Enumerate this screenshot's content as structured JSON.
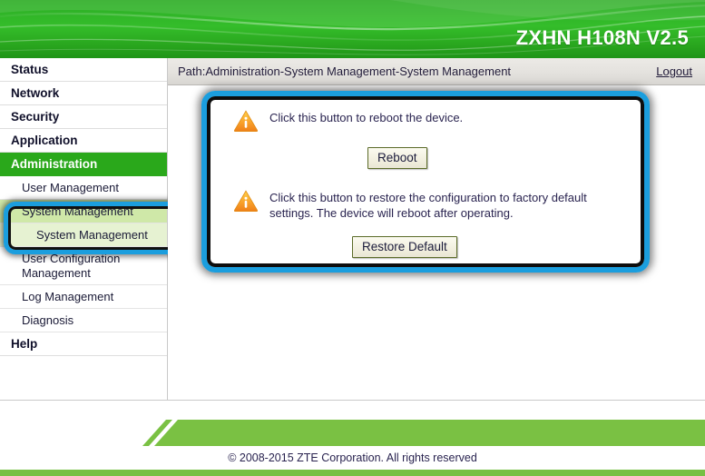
{
  "header": {
    "model_title": "ZXHN H108N V2.5",
    "banner_color": "#2fb327"
  },
  "pathbar": {
    "path": "Path:Administration-System Management-System Management",
    "logout": "Logout"
  },
  "sidebar": {
    "top_items": [
      {
        "label": "Status",
        "active": false
      },
      {
        "label": "Network",
        "active": false
      },
      {
        "label": "Security",
        "active": false
      },
      {
        "label": "Application",
        "active": false
      },
      {
        "label": "Administration",
        "active": true
      }
    ],
    "sub_items": [
      {
        "label": "User Management"
      },
      {
        "label": "System Management"
      },
      {
        "label": "System Management"
      },
      {
        "label": "User Configuration Management"
      },
      {
        "label": "Log Management"
      },
      {
        "label": "Diagnosis"
      }
    ],
    "help_item": {
      "label": "Help"
    },
    "help_link": {
      "icon": "question-circle-icon",
      "label": "Help"
    },
    "highlight_color": "#1b9ede"
  },
  "main": {
    "reboot_block": {
      "icon": "warning-triangle-icon",
      "text": "Click this button to reboot the device.",
      "button_label": "Reboot"
    },
    "restore_block": {
      "icon": "warning-triangle-icon",
      "text": "Click this button to restore the configuration to factory default settings. The device will reboot after operating.",
      "button_label": "Restore Default"
    },
    "highlight_color": "#1b9ede"
  },
  "footer": {
    "copyright": "© 2008-2015 ZTE Corporation. All rights reserved",
    "accent_color": "#76c043"
  }
}
